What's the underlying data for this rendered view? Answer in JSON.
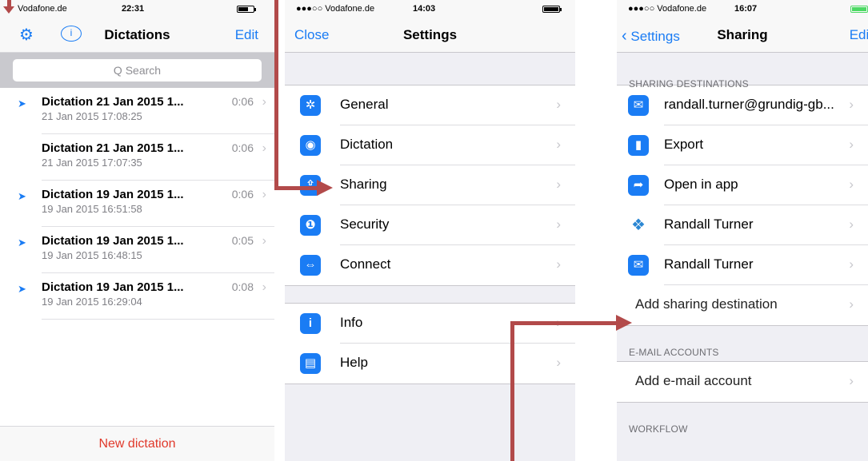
{
  "screen1": {
    "status": {
      "carrier": "Vodafone.de",
      "time": "22:31"
    },
    "nav": {
      "title": "Dictations",
      "edit": "Edit"
    },
    "search_placeholder": "Q Search",
    "dictations": [
      {
        "name": "Dictation 21 Jan 2015 1...",
        "date": "21 Jan 2015 17:08:25",
        "duration": "0:06",
        "sent": true
      },
      {
        "name": "Dictation 21 Jan 2015 1...",
        "date": "21 Jan 2015 17:07:35",
        "duration": "0:06",
        "sent": false
      },
      {
        "name": "Dictation 19 Jan 2015 1...",
        "date": "19 Jan 2015 16:51:58",
        "duration": "0:06",
        "sent": true
      },
      {
        "name": "Dictation 19 Jan 2015 1...",
        "date": "19 Jan 2015 16:48:15",
        "duration": "0:05",
        "sent": true
      },
      {
        "name": "Dictation 19 Jan 2015 1...",
        "date": "19 Jan 2015 16:29:04",
        "duration": "0:08",
        "sent": true
      }
    ],
    "new_dictation": "New dictation"
  },
  "screen2": {
    "status": {
      "carrier": "●●●○○ Vodafone.de",
      "time": "14:03"
    },
    "nav": {
      "close": "Close",
      "title": "Settings"
    },
    "group1": [
      {
        "label": "General",
        "icon": "gear-icon"
      },
      {
        "label": "Dictation",
        "icon": "record-icon"
      },
      {
        "label": "Sharing",
        "icon": "share-icon"
      },
      {
        "label": "Security",
        "icon": "lock-icon"
      },
      {
        "label": "Connect",
        "icon": "connect-icon"
      }
    ],
    "group2": [
      {
        "label": "Info",
        "icon": "info-icon"
      },
      {
        "label": "Help",
        "icon": "book-icon"
      }
    ]
  },
  "screen3": {
    "status": {
      "carrier": "●●●○○ Vodafone.de",
      "time": "16:07"
    },
    "nav": {
      "back": "Settings",
      "title": "Sharing",
      "edit": "Edit"
    },
    "section_destinations": "SHARING DESTINATIONS",
    "destinations": [
      {
        "label": "randall.turner@grundig-gb...",
        "icon": "mail-icon"
      },
      {
        "label": "Export",
        "icon": "usb-icon"
      },
      {
        "label": "Open in app",
        "icon": "open-in-app-icon"
      },
      {
        "label": "Randall Turner",
        "icon": "dropbox-icon"
      },
      {
        "label": "Randall Turner",
        "icon": "mail-icon"
      }
    ],
    "add_destination": "Add sharing destination",
    "section_email": "E-MAIL ACCOUNTS",
    "add_email": "Add e-mail account",
    "section_workflow": "WORKFLOW"
  },
  "colors": {
    "accent": "#1a7cf4",
    "arrow": "#b24a4a",
    "danger": "#e0392b"
  }
}
